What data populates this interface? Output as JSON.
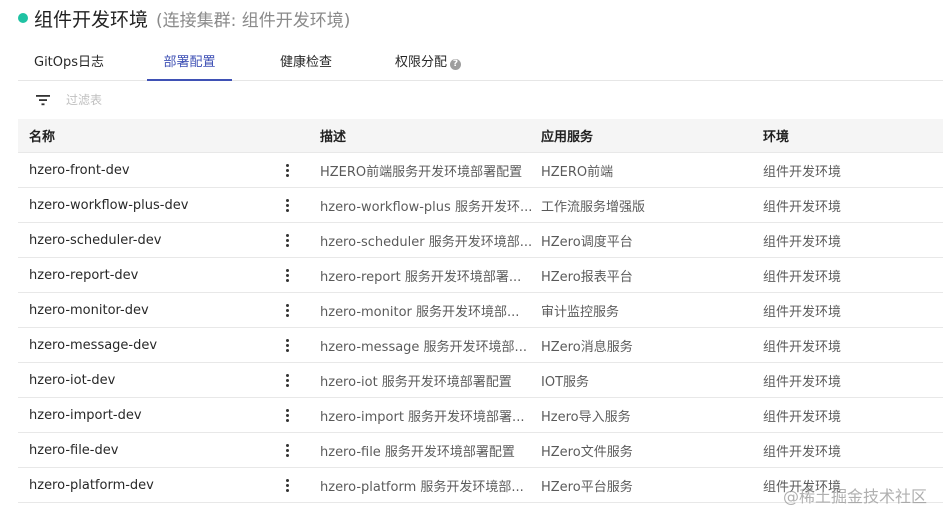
{
  "header": {
    "title": "组件开发环境",
    "subtitle": "(连接集群: 组件开发环境)",
    "status_color": "#1fc2a3"
  },
  "tabs": [
    {
      "label": "GitOps日志",
      "active": false
    },
    {
      "label": "部署配置",
      "active": true
    },
    {
      "label": "健康检查",
      "active": false
    },
    {
      "label": "权限分配",
      "active": false,
      "help_icon": "?"
    }
  ],
  "filter": {
    "icon": "filter-icon",
    "placeholder": "过滤表"
  },
  "table": {
    "columns": [
      "名称",
      "描述",
      "应用服务",
      "环境"
    ],
    "rows": [
      {
        "name": "hzero-front-dev",
        "desc": "HZERO前端服务开发环境部署配置",
        "app": "HZERO前端",
        "env": "组件开发环境"
      },
      {
        "name": "hzero-workflow-plus-dev",
        "desc": "hzero-workflow-plus 服务开发环...",
        "app": "工作流服务增强版",
        "env": "组件开发环境"
      },
      {
        "name": "hzero-scheduler-dev",
        "desc": "hzero-scheduler 服务开发环境部...",
        "app": "HZero调度平台",
        "env": "组件开发环境"
      },
      {
        "name": "hzero-report-dev",
        "desc": "hzero-report 服务开发环境部署...",
        "app": "HZero报表平台",
        "env": "组件开发环境"
      },
      {
        "name": "hzero-monitor-dev",
        "desc": "hzero-monitor 服务开发环境部...",
        "app": "审计监控服务",
        "env": "组件开发环境"
      },
      {
        "name": "hzero-message-dev",
        "desc": "hzero-message 服务开发环境部...",
        "app": "HZero消息服务",
        "env": "组件开发环境"
      },
      {
        "name": "hzero-iot-dev",
        "desc": "hzero-iot 服务开发环境部署配置",
        "app": "IOT服务",
        "env": "组件开发环境"
      },
      {
        "name": "hzero-import-dev",
        "desc": "hzero-import 服务开发环境部署...",
        "app": "Hzero导入服务",
        "env": "组件开发环境"
      },
      {
        "name": "hzero-file-dev",
        "desc": "hzero-file 服务开发环境部署配置",
        "app": "HZero文件服务",
        "env": "组件开发环境"
      },
      {
        "name": "hzero-platform-dev",
        "desc": "hzero-platform 服务开发环境部...",
        "app": "HZero平台服务",
        "env": "组件开发环境"
      }
    ]
  },
  "watermark": "@稀土掘金技术社区",
  "colors": {
    "accent": "#3f51b5",
    "header_bg": "#f5f5f5"
  }
}
